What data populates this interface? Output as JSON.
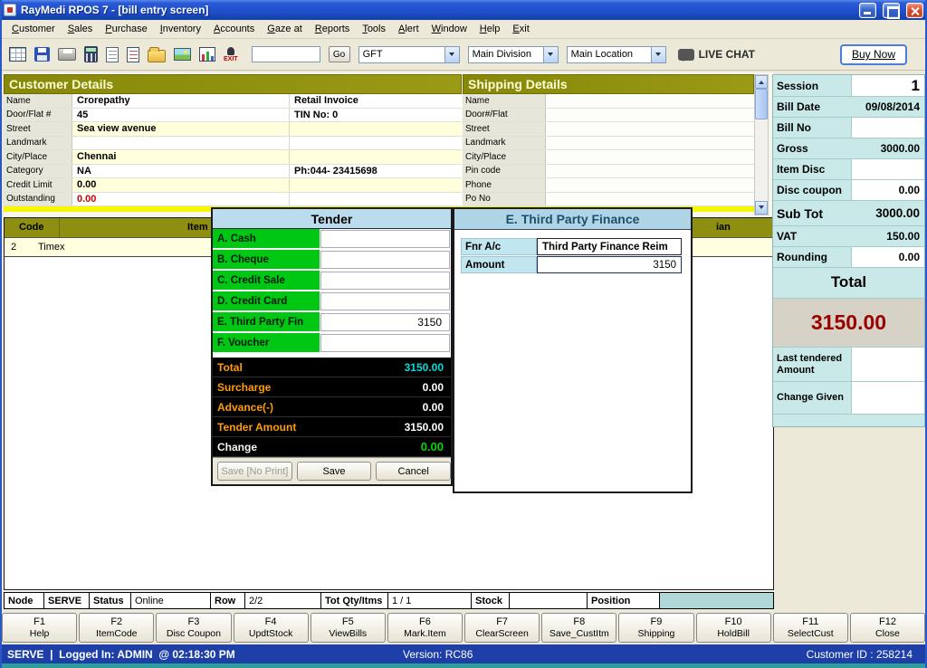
{
  "titlebar": {
    "title": "RayMedi RPOS 7 - [bill entry screen]"
  },
  "menu": {
    "items": [
      "Customer",
      "Sales",
      "Purchase",
      "Inventory",
      "Accounts",
      "Gaze at",
      "Reports",
      "Tools",
      "Alert",
      "Window",
      "Help",
      "Exit"
    ]
  },
  "toolbar": {
    "search_value": "",
    "go": "Go",
    "branch_dropdown": "GFT",
    "division_dropdown": "Main Division",
    "location_dropdown": "Main Location",
    "live_chat": "LIVE CHAT",
    "buy_now": "Buy Now",
    "exit_icon_label": "EXIT"
  },
  "customer": {
    "title": "Customer Details",
    "rows": [
      {
        "label": "Name",
        "value": "Crorepathy",
        "value2": "Retail Invoice"
      },
      {
        "label": "Door/Flat #",
        "value": "45",
        "value2": "TIN No: 0"
      },
      {
        "label": "Street",
        "value": "Sea view avenue",
        "value2": ""
      },
      {
        "label": "Landmark",
        "value": "",
        "value2": ""
      },
      {
        "label": "City/Place",
        "value": "Chennai",
        "value2": ""
      },
      {
        "label": "Category",
        "value": "NA",
        "value2": "Ph:044- 23415698"
      },
      {
        "label": "Credit Limit",
        "value": "0.00",
        "value2": ""
      },
      {
        "label": "Outstanding",
        "value": "0.00",
        "value2": ""
      }
    ]
  },
  "shipping": {
    "title": "Shipping Details",
    "labels": [
      "Name",
      "Door#/Flat",
      "Street",
      "Landmark",
      "City/Place",
      "Pin code",
      "Phone",
      "Po No"
    ]
  },
  "items": {
    "col_code": "Code",
    "col_item": "Item",
    "col_fragment": "ian",
    "rows": [
      {
        "code": "2",
        "name": "Timex"
      }
    ]
  },
  "session": {
    "rows": [
      {
        "label": "Session",
        "value": "1"
      },
      {
        "label": "Bill Date",
        "value": "09/08/2014"
      },
      {
        "label": "Bill No",
        "value": ""
      },
      {
        "label": "Gross",
        "value": "3000.00"
      },
      {
        "label": "Item Disc",
        "value": ""
      },
      {
        "label": "Disc coupon",
        "value": "0.00"
      },
      {
        "label": "Sub Tot",
        "value": "3000.00"
      },
      {
        "label": "VAT",
        "value": "150.00"
      },
      {
        "label": "Rounding",
        "value": "0.00"
      }
    ],
    "total_label": "Total",
    "total_value": "3150.00",
    "last_tendered": {
      "label": "Last tendered Amount",
      "value": ""
    },
    "change_given": {
      "label": "Change Given",
      "value": ""
    }
  },
  "tender": {
    "title": "Tender",
    "modes": [
      {
        "label": "A. Cash",
        "value": ""
      },
      {
        "label": "B. Cheque",
        "value": ""
      },
      {
        "label": "C. Credit Sale",
        "value": ""
      },
      {
        "label": "D. Credit Card",
        "value": ""
      },
      {
        "label": "E. Third Party Fin",
        "value": "3150"
      },
      {
        "label": "F. Voucher",
        "value": ""
      }
    ],
    "totals": [
      {
        "label": "Total",
        "value": "3150.00"
      },
      {
        "label": "Surcharge",
        "value": "0.00"
      },
      {
        "label": "Advance(-)",
        "value": "0.00"
      },
      {
        "label": "Tender Amount",
        "value": "3150.00"
      },
      {
        "label": "Change",
        "value": "0.00"
      }
    ],
    "buttons": [
      "Save [No Print]",
      "Save",
      "Cancel"
    ]
  },
  "third_party": {
    "title": "E. Third Party Finance",
    "rows": [
      {
        "label": "Fnr A/c",
        "value": "Third Party Finance Reim"
      },
      {
        "label": "Amount",
        "value": "3150"
      }
    ]
  },
  "status": {
    "cells": [
      "Node",
      "SERVE",
      "Status",
      "Online",
      "Row",
      "2/2",
      "Tot Qty/Itms",
      "1 / 1",
      "Stock",
      "",
      "Position",
      ""
    ]
  },
  "fkeys": [
    {
      "key": "F1",
      "label": "Help"
    },
    {
      "key": "F2",
      "label": "ItemCode"
    },
    {
      "key": "F3",
      "label": "Disc Coupon"
    },
    {
      "key": "F4",
      "label": "UpdtStock"
    },
    {
      "key": "F5",
      "label": "ViewBills"
    },
    {
      "key": "F6",
      "label": "Mark.Item"
    },
    {
      "key": "F7",
      "label": "ClearScreen"
    },
    {
      "key": "F8",
      "label": "Save_CustItm"
    },
    {
      "key": "F9",
      "label": "Shipping"
    },
    {
      "key": "F10",
      "label": "HoldBill"
    },
    {
      "key": "F11",
      "label": "SelectCust"
    },
    {
      "key": "F12",
      "label": "Close"
    }
  ],
  "footer": {
    "left": "SERVE  |  Logged In: ADMIN  @ 02:18:30 PM",
    "center": "Version: RC86",
    "right": "Customer ID : 258214"
  },
  "colors": {
    "olive_header": "#8E8E10",
    "tender_green": "#00C614",
    "tender_label_orange": "#FF9C00",
    "tender_total_cyan": "#00DCDC",
    "change_green": "#00D800",
    "grand_total_red": "#990000",
    "session_cyan": "#C9E9E9",
    "footer_navy": "#1E3FA8",
    "teal_strip": "#2E9E9C"
  }
}
